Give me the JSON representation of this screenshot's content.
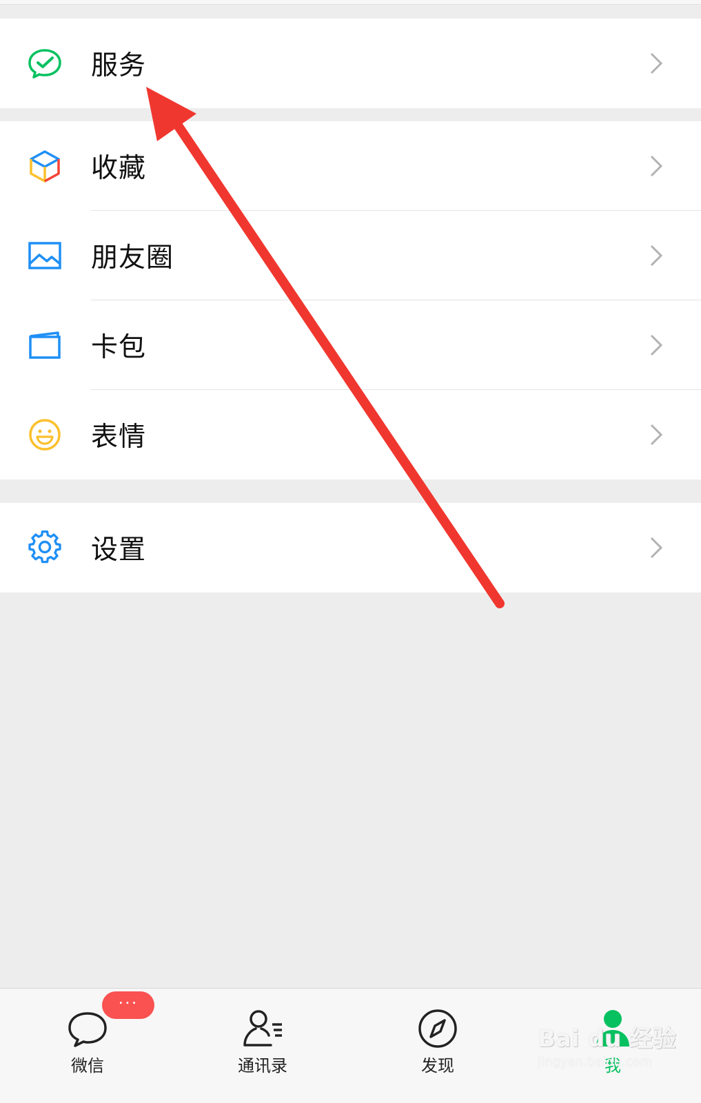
{
  "menu": {
    "services": {
      "label": "服务",
      "icon": "wechat-pay-check-icon",
      "color": "#07c160"
    },
    "favorites": {
      "label": "收藏",
      "icon": "cube-icon"
    },
    "moments": {
      "label": "朋友圈",
      "icon": "picture-icon",
      "color": "#1f8ff5"
    },
    "cards": {
      "label": "卡包",
      "icon": "card-wallet-icon",
      "color": "#1f8ff5"
    },
    "stickers": {
      "label": "表情",
      "icon": "smiley-icon",
      "color": "#fbc02d"
    },
    "settings": {
      "label": "设置",
      "icon": "gear-icon",
      "color": "#1f8ff5"
    }
  },
  "tabbar": {
    "tabs": [
      {
        "label": "微信",
        "icon": "chat-bubble-icon",
        "badge": "···"
      },
      {
        "label": "通讯录",
        "icon": "contacts-icon"
      },
      {
        "label": "发现",
        "icon": "compass-icon"
      },
      {
        "label": "我",
        "icon": "person-icon",
        "active": true
      }
    ]
  },
  "watermark": {
    "logo": "Bai du 经验",
    "sub": "jingyan.baidu.com"
  },
  "colors": {
    "accent": "#07c160",
    "arrow": "#f0372f",
    "badge": "#fa5151",
    "background": "#ededed"
  }
}
